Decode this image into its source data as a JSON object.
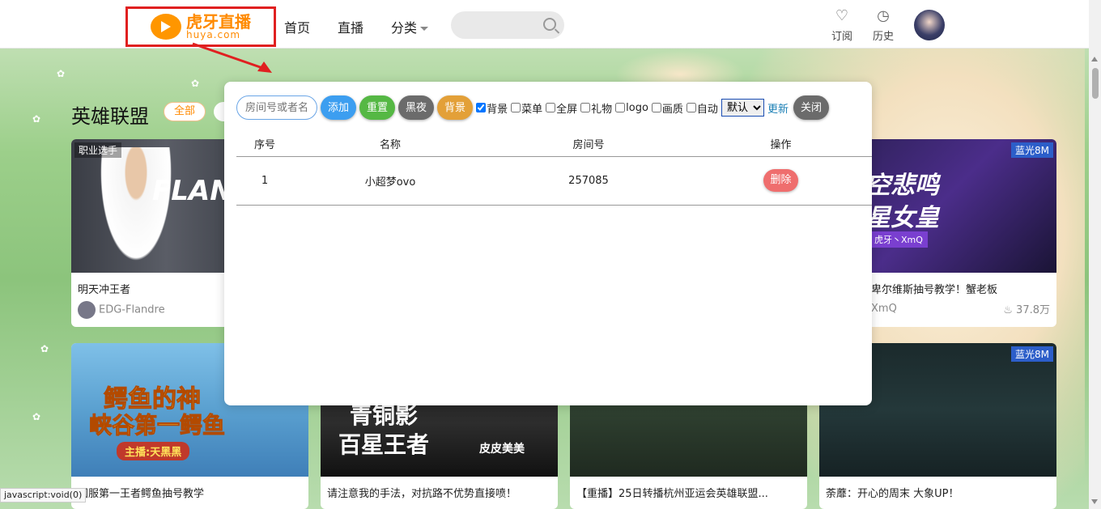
{
  "header": {
    "logo_cn": "虎牙直播",
    "logo_en": "huya.com",
    "nav": [
      "首页",
      "直播",
      "分类"
    ],
    "subscribe_label": "订阅",
    "history_label": "历史"
  },
  "section": {
    "title": "英雄联盟",
    "chip_all": "全部"
  },
  "cards": [
    {
      "tag": "职业选手",
      "title": "明天冲王者",
      "streamer": "EDG-Flandre",
      "thumb_text": "FLAN"
    },
    {
      "badge": "蓝光8M",
      "title": "卑尔维斯抽号教学！蟹老板",
      "streamer": "XmQ",
      "viewers": "37.8万",
      "thumb_text1": "空悲鸣",
      "thumb_text2": "星女皇",
      "thumb_tag": "虎牙丶XmQ"
    },
    {
      "title": "国服第一王者鳄鱼抽号教学",
      "thumb_text1": "鳄鱼的神",
      "thumb_text2": "峡谷第一鳄鱼",
      "thumb_tag": "主播:天黑黑"
    },
    {
      "title": "请注意我的手法，对抗路不优势直接喷！",
      "thumb_text1": "青铜影",
      "thumb_text2": "百星王者",
      "thumb_tag": "皮皮美美"
    },
    {
      "title": "【重播】25日转播杭州亚运会英雄联盟..."
    },
    {
      "badge": "蓝光8M",
      "title": "荼蘼：开心的周末 大象UP！"
    }
  ],
  "panel": {
    "room_input_placeholder": "房间号或者名",
    "btn_add": "添加",
    "btn_reset": "重置",
    "btn_dark": "黑夜",
    "btn_bg": "背景",
    "checkboxes": [
      {
        "label": "背景",
        "checked": true
      },
      {
        "label": "菜单",
        "checked": false
      },
      {
        "label": "全屏",
        "checked": false
      },
      {
        "label": "礼物",
        "checked": false
      },
      {
        "label": "logo",
        "checked": false
      },
      {
        "label": "画质",
        "checked": false
      },
      {
        "label": "自动",
        "checked": false
      }
    ],
    "select_value": "默认",
    "update_link": "更新",
    "btn_close": "关闭",
    "table_headers": [
      "序号",
      "名称",
      "房间号",
      "操作"
    ],
    "rows": [
      {
        "index": "1",
        "name": "小超梦ovo",
        "room": "257085",
        "action": "删除"
      }
    ]
  },
  "statusbar": "javascript:void(0)"
}
